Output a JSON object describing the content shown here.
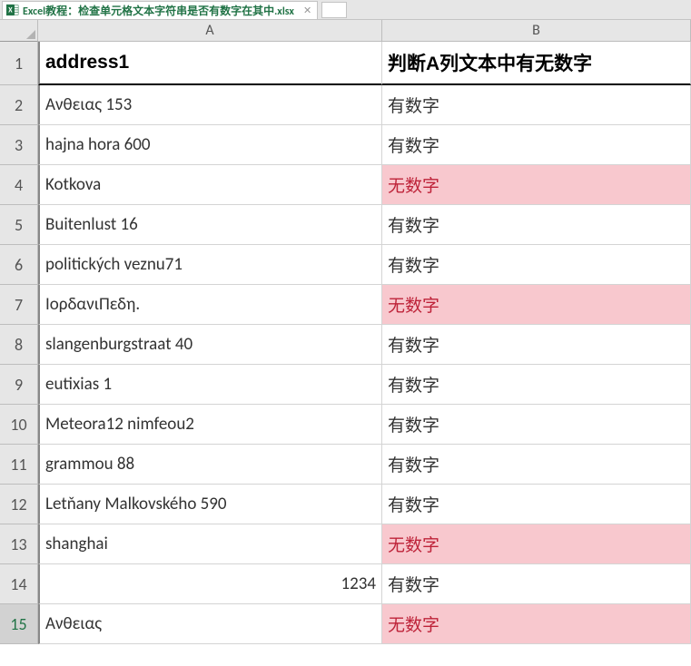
{
  "tab": {
    "filename": "Excel教程：检查单元格文本字符串是否有数字在其中.xlsx"
  },
  "columns": [
    "A",
    "B"
  ],
  "headers": {
    "A": "address1",
    "B": "判断A列文本中有无数字"
  },
  "results": {
    "has": "有数字",
    "none": "无数字"
  },
  "rows": [
    {
      "n": 2,
      "a": "Ανθειας 153",
      "has_digit": true
    },
    {
      "n": 3,
      "a": "hajna hora 600",
      "has_digit": true
    },
    {
      "n": 4,
      "a": "Kotkova",
      "has_digit": false
    },
    {
      "n": 5,
      "a": "Buitenlust 16",
      "has_digit": true
    },
    {
      "n": 6,
      "a": "politických veznu71",
      "has_digit": true
    },
    {
      "n": 7,
      "a": "ΙορδανιΠεδη.",
      "has_digit": false
    },
    {
      "n": 8,
      "a": "slangenburgstraat 40",
      "has_digit": true
    },
    {
      "n": 9,
      "a": "eutixias 1",
      "has_digit": true
    },
    {
      "n": 10,
      "a": "Meteora12 nimfeou2",
      "has_digit": true
    },
    {
      "n": 11,
      "a": "grammou 88",
      "has_digit": true
    },
    {
      "n": 12,
      "a": "Letňany Malkovského 590",
      "has_digit": true
    },
    {
      "n": 13,
      "a": "shanghai",
      "has_digit": false
    },
    {
      "n": 14,
      "a": "1234",
      "has_digit": true,
      "numeric": true
    },
    {
      "n": 15,
      "a": "Ανθειας",
      "has_digit": false
    }
  ],
  "selected_row": 15
}
